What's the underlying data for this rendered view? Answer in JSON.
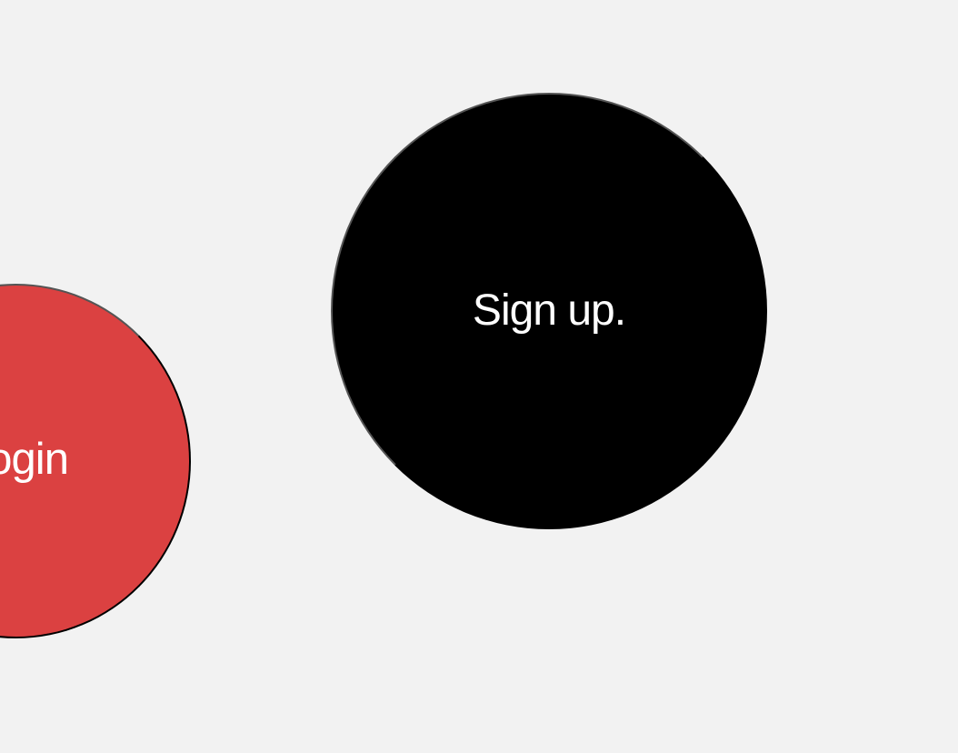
{
  "buttons": {
    "login": {
      "label": "Login"
    },
    "signup": {
      "label": "Sign up."
    }
  },
  "colors": {
    "background": "#f2f2f2",
    "login": "#db4141",
    "signup": "#000000",
    "text": "#ffffff"
  }
}
